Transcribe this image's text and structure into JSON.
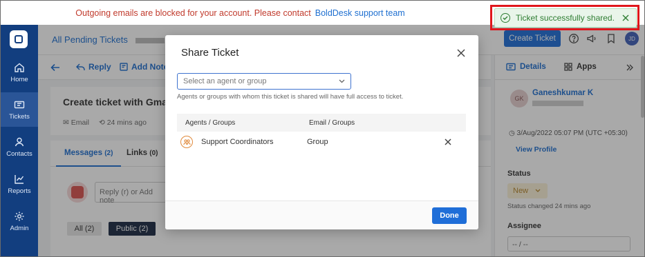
{
  "banner": {
    "warning": "Outgoing emails are blocked for your account. Please contact",
    "link": "BoldDesk support team"
  },
  "toast": {
    "message": "Ticket successfully shared.",
    "icon": "check-circle-icon",
    "color": "#2e7d32",
    "outline_color": "#e0161b"
  },
  "leftnav": {
    "items": [
      {
        "label": "Home",
        "icon": "home-icon"
      },
      {
        "label": "Tickets",
        "icon": "ticket-icon"
      },
      {
        "label": "Contacts",
        "icon": "contacts-icon"
      },
      {
        "label": "Reports",
        "icon": "reports-icon"
      },
      {
        "label": "Admin",
        "icon": "gear-icon"
      }
    ],
    "active": "Tickets",
    "bg_color": "#123e7f"
  },
  "header": {
    "breadcrumb": "All Pending Tickets",
    "create_button": "Create Ticket",
    "avatar_initials": "JD"
  },
  "toolbar": {
    "reply": "Reply",
    "add_note": "Add Note"
  },
  "ticket": {
    "title": "Create ticket with Gmail",
    "source": "Email",
    "time": "24 mins ago"
  },
  "messages": {
    "tabs": [
      {
        "label": "Messages",
        "count": "(2)"
      },
      {
        "label": "Links",
        "count": "(0)"
      }
    ],
    "reply_placeholder": "Reply (r) or Add note",
    "filters": [
      "All (2)",
      "Public (2)"
    ]
  },
  "rightpane": {
    "tabs": [
      "Details",
      "Apps"
    ],
    "requester_initials": "GK",
    "requester_name": "Ganeshkumar K",
    "date": "3/Aug/2022 05:07 PM (UTC +05:30)",
    "view_profile": "View Profile",
    "status_label": "Status",
    "status_value": "New",
    "status_changed": "Status changed 24 mins ago",
    "assignee_label": "Assignee",
    "assignee_value": "-- / --"
  },
  "modal": {
    "title": "Share Ticket",
    "select_placeholder": "Select an agent or group",
    "helper": "Agents or groups with whom this ticket is shared will have full access to ticket.",
    "columns": [
      "Agents / Groups",
      "Email / Groups"
    ],
    "rows": [
      {
        "name": "Support Coordinators",
        "type": "Group",
        "icon": "group-icon"
      }
    ],
    "done_label": "Done",
    "accent": "#1f6ed8"
  }
}
